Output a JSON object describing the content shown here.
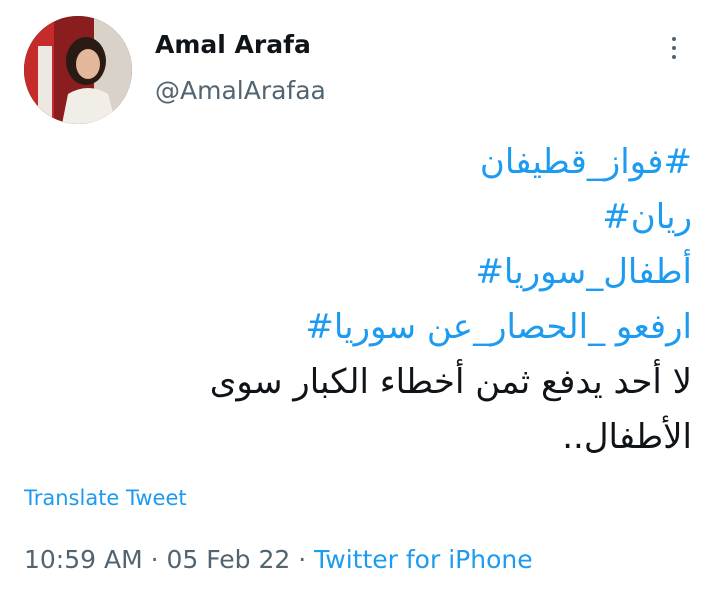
{
  "author": {
    "display_name": "Amal Arafa",
    "handle": "@AmalArafaa"
  },
  "more_icon": "more-vertical-icon",
  "tweet": {
    "lines": [
      "#فواز_قطيفان",
      "ريان#",
      "أطفال_سوريا#",
      "ارفعو _الحصار_عن سوريا#",
      "لا أحد يدفع  ثمن أخطاء الكبار سوى",
      "الأطفال.."
    ]
  },
  "translate_label": "Translate Tweet",
  "meta": {
    "time": "10:59 AM",
    "separator": " · ",
    "date": "05 Feb 22",
    "source": "Twitter for iPhone"
  },
  "colors": {
    "link": "#1d9bf0",
    "text": "#0f1419",
    "secondary": "#536471"
  }
}
